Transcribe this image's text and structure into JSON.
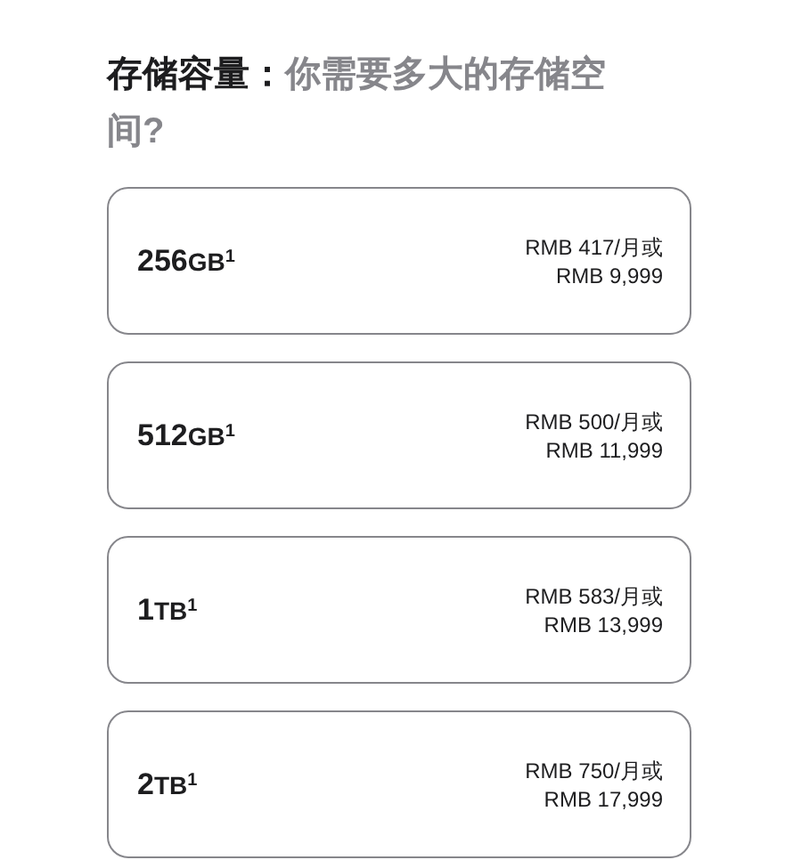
{
  "heading": {
    "lead": "存储容量：",
    "rest": "你需要多大的存储空间?"
  },
  "options": [
    {
      "amount": "256",
      "unit": "GB",
      "note": "1",
      "monthly": "RMB 417/月或",
      "total": "RMB 9,999"
    },
    {
      "amount": "512",
      "unit": "GB",
      "note": "1",
      "monthly": "RMB 500/月或",
      "total": "RMB 11,999"
    },
    {
      "amount": "1",
      "unit": "TB",
      "note": "1",
      "monthly": "RMB 583/月或",
      "total": "RMB 13,999"
    },
    {
      "amount": "2",
      "unit": "TB",
      "note": "1",
      "monthly": "RMB 750/月或",
      "total": "RMB 17,999"
    }
  ]
}
